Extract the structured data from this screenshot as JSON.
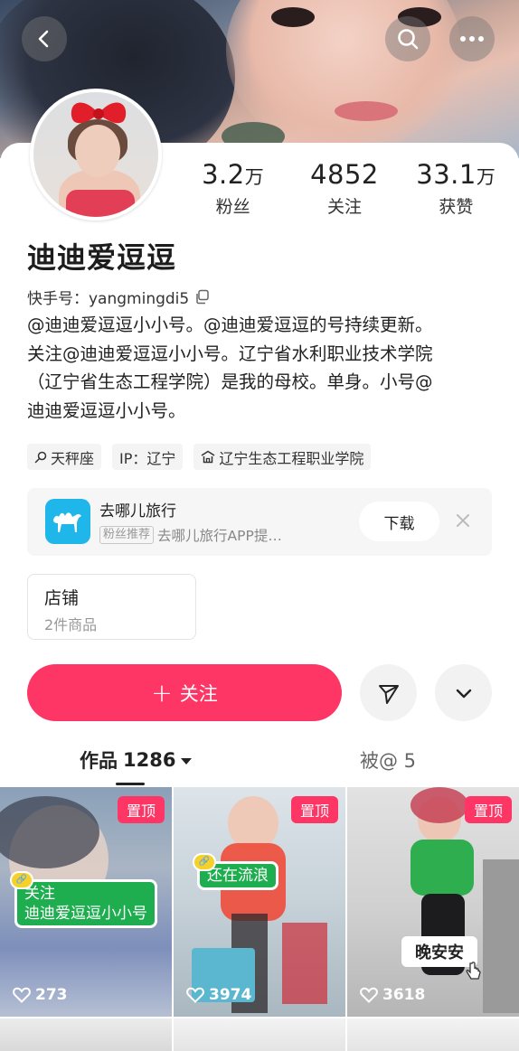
{
  "header": {
    "back_icon": "chevron-left-icon",
    "search_icon": "search-icon",
    "more_icon": "more-dots-icon"
  },
  "profile": {
    "nickname": "迪迪爱逗逗",
    "stats": [
      {
        "value": "3.2",
        "unit": "万",
        "label": "粉丝"
      },
      {
        "value": "4852",
        "unit": "",
        "label": "关注"
      },
      {
        "value": "33.1",
        "unit": "万",
        "label": "获赞"
      }
    ],
    "kuaishou_id_label": "快手号：yangmingdi5",
    "bio_lines": [
      "@迪迪爱逗逗小小号。@迪迪爱逗逗的号持续更新。",
      "关注@迪迪爱逗逗小小号。辽宁省水利职业技术学院",
      "（辽宁省生态工程学院）是我的母校。单身。小号@",
      "迪迪爱逗逗小小号。"
    ],
    "tags": [
      {
        "icon": "libra-icon",
        "text": "天秤座"
      },
      {
        "icon": "",
        "text": "IP：辽宁"
      },
      {
        "icon": "school-icon",
        "text": "辽宁生态工程职业学院"
      }
    ]
  },
  "ad": {
    "app_name": "去哪儿旅行",
    "badge": "粉丝推荐",
    "desc": "去哪儿旅行APP提…",
    "download_label": "下载"
  },
  "shop": {
    "title": "店铺",
    "subtitle": "2件商品"
  },
  "actions": {
    "follow_label": "关注"
  },
  "tabs": {
    "works_label": "作品",
    "works_count": "1286",
    "mentions_label": "被@ 5"
  },
  "grid": [
    {
      "pinned": "置顶",
      "likes": "273",
      "sticker": [
        "关注",
        "迪迪爱逗逗小小号"
      ]
    },
    {
      "pinned": "置顶",
      "likes": "3974",
      "sticker": [
        "还在流浪"
      ]
    },
    {
      "pinned": "置顶",
      "likes": "3618",
      "caption": "晚安安"
    }
  ],
  "colors": {
    "accent": "#fe3666",
    "sticker_green": "#1fae4f",
    "app_blue": "#1fb6e9"
  }
}
